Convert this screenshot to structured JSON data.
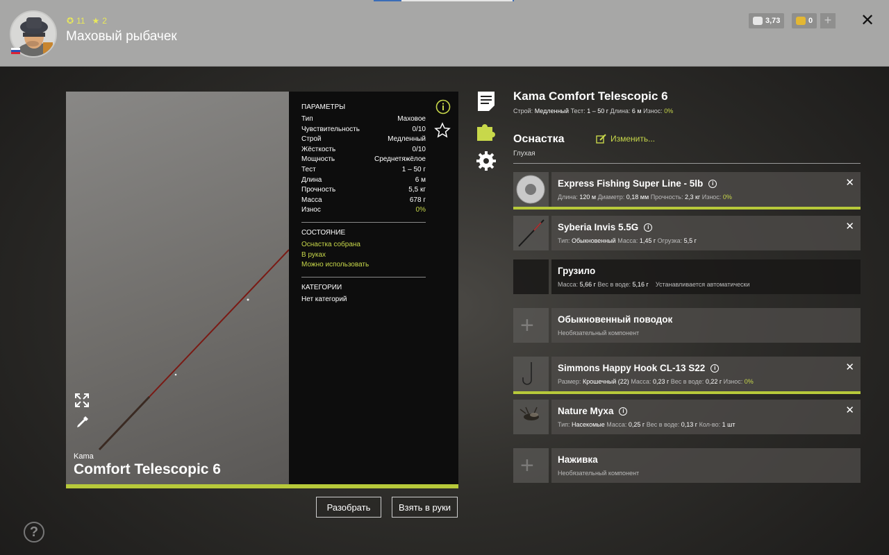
{
  "player": {
    "name": "Маховый рыбачек",
    "level": "11",
    "rank": "2",
    "silver": "3,73",
    "gold": "0"
  },
  "rod": {
    "brand": "Kama",
    "model": "Comfort Telescopic 6",
    "full_title": "Kama Comfort Telescopic 6",
    "summary": {
      "action_label": "Строй:",
      "action_value": "Медленный",
      "test_label": "Тест:",
      "test_value": "1 – 50 г",
      "length_label": "Длина:",
      "length_value": "6 м",
      "wear_label": "Износ:",
      "wear_value": "0%"
    }
  },
  "params": {
    "title": "ПАРАМЕТРЫ",
    "rows": [
      {
        "label": "Тип",
        "value": "Маховое"
      },
      {
        "label": "Чувствительность",
        "value": "0/10"
      },
      {
        "label": "Строй",
        "value": "Медленный"
      },
      {
        "label": "Жёсткость",
        "value": "0/10"
      },
      {
        "label": "Мощность",
        "value": "Среднетяжёлое"
      },
      {
        "label": "Тест",
        "value": "1 – 50 г"
      },
      {
        "label": "Длина",
        "value": "6 м"
      },
      {
        "label": "Прочность",
        "value": "5,5 кг"
      },
      {
        "label": "Масса",
        "value": "678 г"
      },
      {
        "label": "Износ",
        "value": "0%"
      }
    ],
    "state_title": "СОСТОЯНИЕ",
    "states": [
      "Оснастка собрана",
      "В руках",
      "Можно использовать"
    ],
    "categories_title": "КАТЕГОРИИ",
    "categories_value": "Нет категорий"
  },
  "buttons": {
    "disassemble": "Разобрать",
    "take": "Взять в руки"
  },
  "rig": {
    "title": "Оснастка",
    "edit_label": "Изменить...",
    "type": "Глухая",
    "slots": [
      {
        "name": "Express Fishing Super Line - 5lb",
        "meta": [
          [
            "Длина:",
            "120 м"
          ],
          [
            "Диаметр:",
            "0,18 мм"
          ],
          [
            "Прочность:",
            "2,3 кг"
          ],
          [
            "Износ:",
            "0%"
          ]
        ]
      },
      {
        "name": "Syberia Invis 5.5G",
        "meta": [
          [
            "Тип:",
            "Обыкновенный"
          ],
          [
            "Масса:",
            "1,45 г"
          ],
          [
            "Огрузка:",
            "5,5 г"
          ]
        ]
      },
      {
        "name": "Грузило",
        "meta": [
          [
            "Масса:",
            "5,66 г"
          ],
          [
            "Вес в воде:",
            "5,16 г"
          ]
        ],
        "note": "Устанавливается автоматически"
      },
      {
        "name": "Обыкновенный поводок",
        "optional": "Необязательный компонент"
      },
      {
        "name": "Simmons Happy Hook CL-13 S22",
        "meta": [
          [
            "Размер:",
            "Крошечный (22)"
          ],
          [
            "Масса:",
            "0,23 г"
          ],
          [
            "Вес в воде:",
            "0,22 г"
          ],
          [
            "Износ:",
            "0%"
          ]
        ]
      },
      {
        "name": "Nature Муха",
        "meta": [
          [
            "Тип:",
            "Насекомые"
          ],
          [
            "Масса:",
            "0,25 г"
          ],
          [
            "Вес в воде:",
            "0,13 г"
          ],
          [
            "Кол-во:",
            "1 шт"
          ]
        ]
      },
      {
        "name": "Наживка",
        "optional": "Необязательный компонент"
      }
    ]
  },
  "colors": {
    "accent": "#b7c93a",
    "topbar": "#a7a7a6",
    "panel": "#0d0d0d"
  }
}
